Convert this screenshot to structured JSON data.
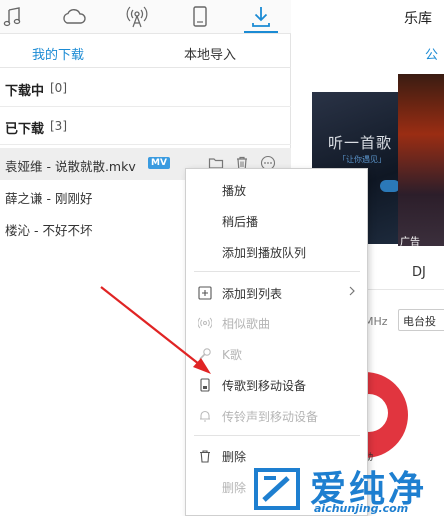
{
  "left_panel": {
    "top_tabs": [
      {
        "icon": "music-note-icon"
      },
      {
        "icon": "cloud-icon"
      },
      {
        "icon": "radio-broadcast-icon"
      },
      {
        "icon": "mobile-device-icon"
      },
      {
        "icon": "download-icon",
        "active": true
      }
    ],
    "sub_tabs": {
      "mine": "我的下载",
      "local": "本地导入"
    },
    "sections": {
      "downloading": {
        "title": "下载中",
        "count": "[0]"
      },
      "downloaded": {
        "title": "已下载",
        "count": "[3]"
      }
    },
    "items": [
      {
        "name": "袁娅维 - 说散就散.mkv",
        "badge": "MV",
        "selected": true
      },
      {
        "name": "薛之谦 - 刚刚好"
      },
      {
        "name": "楼沁 - 不好不坏"
      }
    ]
  },
  "right_panel": {
    "title": "乐库",
    "sub_title": "公",
    "banner_text": "听一首歌",
    "banner_subtext": "「让你遇见」",
    "ad_label": "广告",
    "tab_dj": "DJ",
    "freq_label": "MHz",
    "station_select_value": "电台投",
    "bottom_text": "动"
  },
  "context_menu": {
    "items": [
      {
        "label": "播放",
        "disabled": false
      },
      {
        "label": "稍后播",
        "disabled": false
      },
      {
        "label": "添加到播放队列",
        "disabled": false
      },
      {
        "label": "添加到列表",
        "icon": "plus-box-icon",
        "disabled": false,
        "submenu": true
      },
      {
        "label": "相似歌曲",
        "icon": "similar-radio-icon",
        "disabled": true
      },
      {
        "label": "K歌",
        "icon": "microphone-icon",
        "disabled": true
      },
      {
        "label": "传歌到移动设备",
        "icon": "mobile-transfer-icon",
        "disabled": false
      },
      {
        "label": "传铃声到移动设备",
        "icon": "bell-icon",
        "disabled": true
      },
      {
        "label": "删除",
        "icon": "trash-icon",
        "disabled": false
      },
      {
        "label": "删除（",
        "disabled": true
      }
    ]
  },
  "watermark": {
    "text": "爱纯净",
    "url": "aichunjing.com"
  },
  "colors": {
    "accent": "#1b8bd4",
    "annotation_red": "#e02424",
    "watermark_blue": "#1e7fd0"
  }
}
